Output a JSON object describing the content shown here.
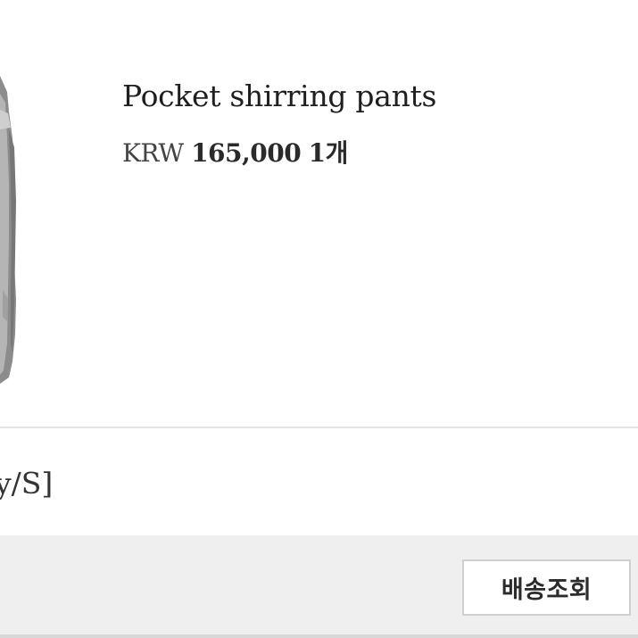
{
  "product": {
    "name": "Pocket shirring pants",
    "currency": "KRW",
    "price": "165,000",
    "quantity": "1개"
  },
  "order_option": {
    "text": "y/S]"
  },
  "footer": {
    "delivery_button_label": "배송조회"
  }
}
